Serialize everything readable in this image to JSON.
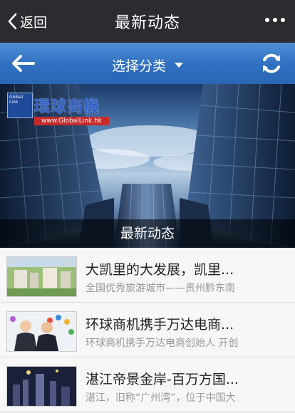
{
  "header": {
    "back_label": "返回",
    "title": "最新动态",
    "more_icon": "ellipsis-icon"
  },
  "category_bar": {
    "label": "选择分类",
    "back_icon": "arrow-left-icon",
    "dropdown_icon": "caret-down-icon",
    "refresh_icon": "refresh-icon",
    "background": "#3a7bd0"
  },
  "banner": {
    "logo_text": "Global Link",
    "logo_brand": "環球商機",
    "logo_url": "www.GlobalLink.hk",
    "caption": "最新动态"
  },
  "news": [
    {
      "title": "大凯里的大发展，凯里...",
      "summary": "全国优秀旅游城市——贵州黔东南"
    },
    {
      "title": "环球商机携手万达电商...",
      "summary": "环球商机携手万达电商创始人 开创"
    },
    {
      "title": "湛江帝景金岸-百万方国...",
      "summary": "湛江，旧称“广州湾”，位于中国大"
    }
  ]
}
